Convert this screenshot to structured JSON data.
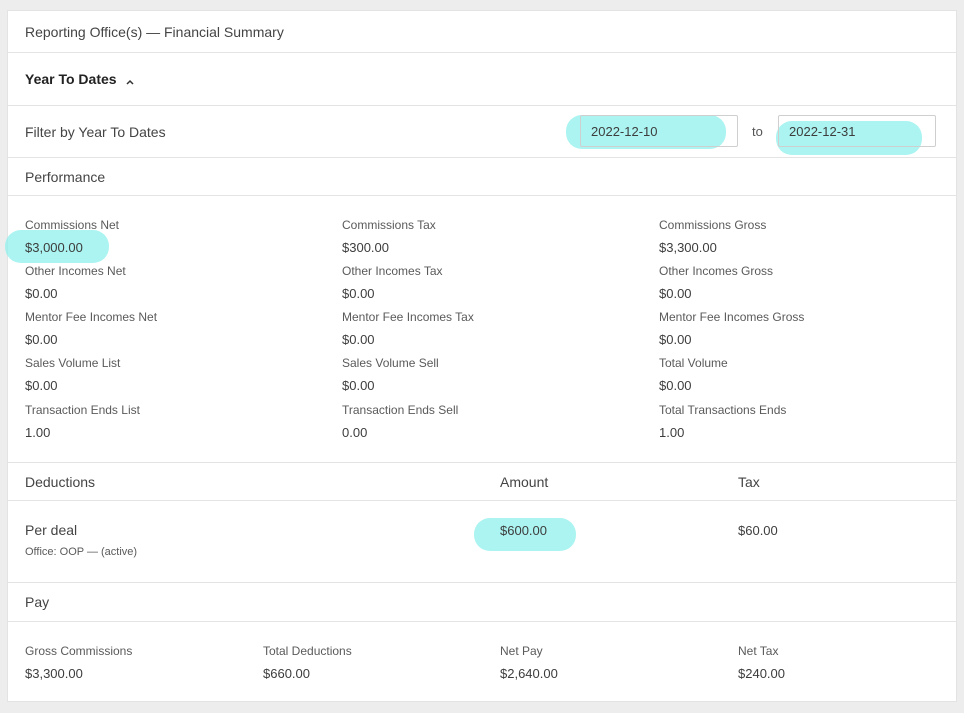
{
  "header": {
    "title": "Reporting Office(s) — Financial Summary"
  },
  "section": {
    "label": "Year To Dates",
    "chevron": "chevron-up-icon"
  },
  "filter": {
    "label": "Filter by Year To Dates",
    "from": "2022-12-10",
    "separator": "to",
    "to": "2022-12-31"
  },
  "performance": {
    "title": "Performance",
    "rows": [
      [
        {
          "label": "Commissions Net",
          "value": "$3,000.00"
        },
        {
          "label": "Commissions Tax",
          "value": "$300.00"
        },
        {
          "label": "Commissions Gross",
          "value": "$3,300.00"
        }
      ],
      [
        {
          "label": "Other Incomes Net",
          "value": "$0.00"
        },
        {
          "label": "Other Incomes Tax",
          "value": "$0.00"
        },
        {
          "label": "Other Incomes Gross",
          "value": "$0.00"
        }
      ],
      [
        {
          "label": "Mentor Fee Incomes Net",
          "value": "$0.00"
        },
        {
          "label": "Mentor Fee Incomes Tax",
          "value": "$0.00"
        },
        {
          "label": "Mentor Fee Incomes Gross",
          "value": "$0.00"
        }
      ],
      [
        {
          "label": "Sales Volume List",
          "value": "$0.00"
        },
        {
          "label": "Sales Volume Sell",
          "value": "$0.00"
        },
        {
          "label": "Total Volume",
          "value": "$0.00"
        }
      ],
      [
        {
          "label": "Transaction Ends List",
          "value": "1.00"
        },
        {
          "label": "Transaction Ends Sell",
          "value": "0.00"
        },
        {
          "label": "Total Transactions Ends",
          "value": "1.00"
        }
      ]
    ]
  },
  "deductions": {
    "headers": [
      "Deductions",
      "Amount",
      "Tax"
    ],
    "item": {
      "name": "Per deal",
      "office": "Office: OOP — (active)",
      "amount": "$600.00",
      "tax": "$60.00"
    }
  },
  "pay": {
    "title": "Pay",
    "items": [
      {
        "label": "Gross Commissions",
        "value": "$3,300.00"
      },
      {
        "label": "Total Deductions",
        "value": "$660.00"
      },
      {
        "label": "Net Pay",
        "value": "$2,640.00"
      },
      {
        "label": "Net Tax",
        "value": "$240.00"
      }
    ]
  },
  "colors": {
    "highlight": "#8ff0ec",
    "border": "#e4e4e4",
    "background": "#ededed"
  }
}
